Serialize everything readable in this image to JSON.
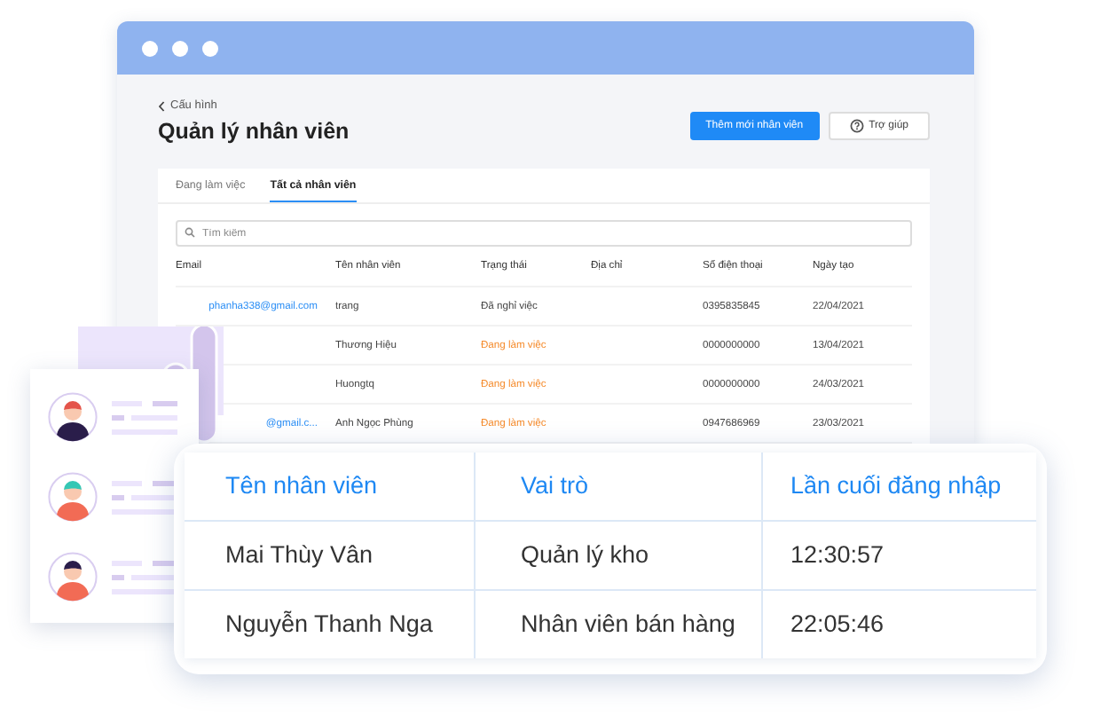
{
  "window": {
    "breadcrumb": "Cấu hình",
    "title": "Quản lý nhân viên",
    "buttons": [
      {
        "label": "Thêm mới nhân viên",
        "kind": "primary"
      },
      {
        "label": "Trợ giúp",
        "kind": "help"
      }
    ],
    "tabs": [
      {
        "label": "Đang làm việc",
        "selected": false
      },
      {
        "label": "Tất cả nhân viên",
        "selected": true
      }
    ],
    "search": {
      "placeholder": "Tìm kiếm"
    },
    "table": {
      "columns": [
        "Email",
        "Tên nhân viên",
        "Trạng thái",
        "Địa chỉ",
        "Số điện thoại",
        "Ngày tạo"
      ],
      "rows": [
        {
          "email": "phanha338@gmail.com",
          "name": "trang",
          "status": "Đã nghỉ việc",
          "active": false,
          "phone": "0395835845",
          "created": "22/04/2021"
        },
        {
          "name": "Thương Hiệu",
          "status": "Đang làm việc",
          "active": true,
          "phone": "0000000000",
          "created": "13/04/2021"
        },
        {
          "name": "Huongtq",
          "status": "Đang làm việc",
          "active": true,
          "phone": "0000000000",
          "created": "24/03/2021"
        },
        {
          "email": "@gmail.c...",
          "name": "Anh Ngọc Phùng",
          "status": "Đang làm việc",
          "active": true,
          "phone": "0947686969",
          "created": "23/03/2021"
        }
      ]
    }
  },
  "login_table": {
    "columns": [
      "Tên nhân viên",
      "Vai trò",
      "Lần cuối đăng nhập"
    ],
    "rows": [
      [
        "Mai Thùy Vân",
        "Quản lý kho",
        "12:30:57"
      ],
      [
        "Nguyễn Thanh Nga",
        "Nhân viên bán hàng",
        "22:05:46"
      ]
    ]
  }
}
